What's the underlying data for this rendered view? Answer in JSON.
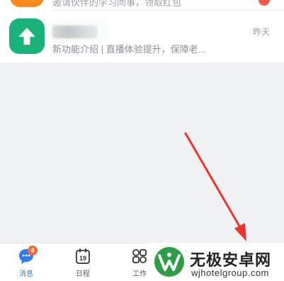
{
  "top_row": {
    "snippet": "邀请伙伴的学习同事，领取红包"
  },
  "message": {
    "time": "昨天",
    "preview": "新功能介绍 | 直播体验提升，保障老..."
  },
  "bottom_nav": {
    "items": [
      {
        "label": "消息",
        "badge": "4",
        "icon": "chat-bubble-icon"
      },
      {
        "label": "日程",
        "day": "19",
        "icon": "calendar-icon"
      },
      {
        "label": "工作",
        "icon": "workspace-icon"
      }
    ]
  },
  "watermark": {
    "title": "无极安卓网",
    "url": "wjhotelgroup.com"
  },
  "colors": {
    "active": "#2b7cf0",
    "badge": "#f56c3a",
    "app_icon": "#19b27a",
    "annotation_arrow": "#e8332e"
  }
}
